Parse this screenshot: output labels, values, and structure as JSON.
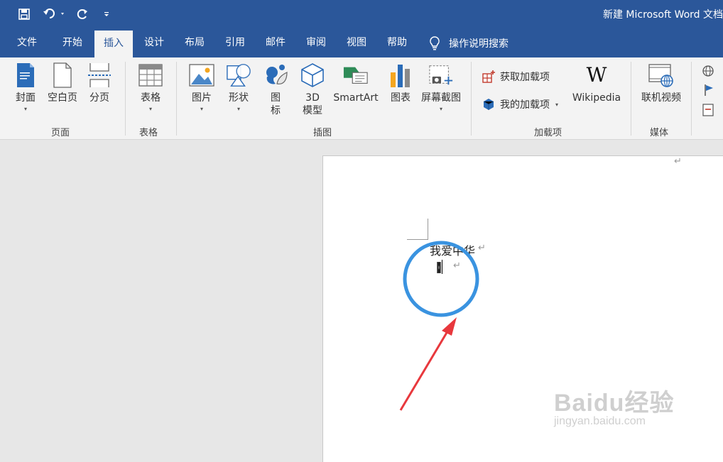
{
  "title_bar": {
    "document_title": "新建 Microsoft Word 文档",
    "quick_access": [
      {
        "icon": "save-icon"
      },
      {
        "icon": "undo-icon"
      },
      {
        "icon": "redo-icon"
      },
      {
        "icon": "customize-icon"
      }
    ]
  },
  "tabs": [
    "文件",
    "开始",
    "插入",
    "设计",
    "布局",
    "引用",
    "邮件",
    "审阅",
    "视图",
    "帮助"
  ],
  "active_tab": "插入",
  "tell_me": "操作说明搜索",
  "ribbon": {
    "groups": {
      "pages": {
        "label": "页面",
        "buttons": [
          {
            "label": "封面",
            "icon": "cover-page-icon"
          },
          {
            "label": "空白页",
            "icon": "blank-page-icon"
          },
          {
            "label": "分页",
            "icon": "page-break-icon"
          }
        ]
      },
      "tables": {
        "label": "表格",
        "buttons": [
          {
            "label": "表格",
            "icon": "table-icon"
          }
        ]
      },
      "illustrations": {
        "label": "插图",
        "buttons": [
          {
            "label": "图片",
            "icon": "picture-icon"
          },
          {
            "label": "形状",
            "icon": "shapes-icon"
          },
          {
            "label": "图标",
            "label_lines": [
              "图",
              "标"
            ],
            "icon": "icons-icon"
          },
          {
            "label": "3D模型",
            "label_lines": [
              "3D",
              "模型"
            ],
            "icon": "3d-model-icon"
          },
          {
            "label": "SmartArt",
            "icon": "smartart-icon"
          },
          {
            "label": "图表",
            "icon": "chart-icon"
          },
          {
            "label": "屏幕截图",
            "icon": "screenshot-icon"
          }
        ]
      },
      "addins": {
        "label": "加载项",
        "buttons": [
          {
            "label": "获取加载项",
            "icon": "get-addins-icon"
          },
          {
            "label": "我的加载项",
            "icon": "my-addins-icon"
          },
          {
            "label": "Wikipedia",
            "icon": "wikipedia-icon",
            "glyph": "W"
          }
        ]
      },
      "media": {
        "label": "媒体",
        "buttons": [
          {
            "label": "联机视频",
            "icon": "online-video-icon"
          }
        ]
      }
    }
  },
  "document": {
    "lines": [
      "我爱中华",
      "【】"
    ],
    "paragraph_mark": "↵"
  },
  "annotation": {
    "circle_color": "#3a93e0",
    "arrow_color": "#e8383d"
  },
  "watermark": {
    "main": "Baidu经验",
    "sub": "jingyan.baidu.com"
  }
}
